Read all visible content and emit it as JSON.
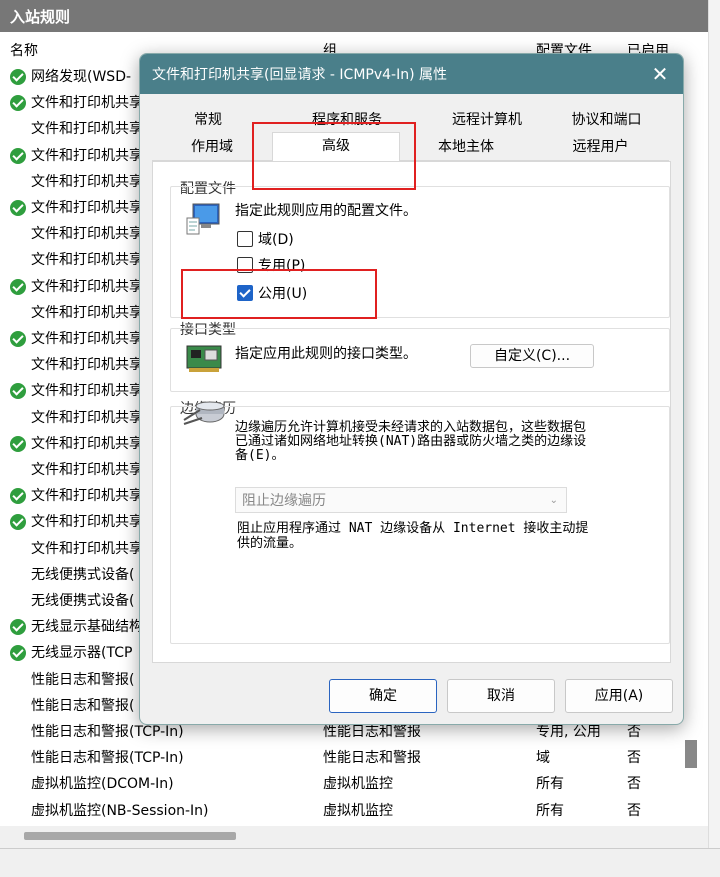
{
  "background_window": {
    "header": "入站规则",
    "columns": [
      "名称",
      "组",
      "配置文件",
      "已启用"
    ],
    "rows": [
      {
        "enabled_icon": true,
        "name": "网络发现(WSD-",
        "group": "",
        "profile": "",
        "enabled": ""
      },
      {
        "enabled_icon": true,
        "name": "文件和打印机共享",
        "group": "",
        "profile": "",
        "enabled": ""
      },
      {
        "enabled_icon": false,
        "name": "文件和打印机共享",
        "group": "",
        "profile": "",
        "enabled": ""
      },
      {
        "enabled_icon": true,
        "name": "文件和打印机共享",
        "group": "",
        "profile": "",
        "enabled": ""
      },
      {
        "enabled_icon": false,
        "name": "文件和打印机共享",
        "group": "",
        "profile": "",
        "enabled": ""
      },
      {
        "enabled_icon": true,
        "name": "文件和打印机共享",
        "group": "",
        "profile": "",
        "enabled": ""
      },
      {
        "enabled_icon": false,
        "name": "文件和打印机共享",
        "group": "",
        "profile": "",
        "enabled": ""
      },
      {
        "enabled_icon": false,
        "name": "文件和打印机共享",
        "group": "",
        "profile": "",
        "enabled": ""
      },
      {
        "enabled_icon": true,
        "name": "文件和打印机共享",
        "group": "",
        "profile": "",
        "enabled": ""
      },
      {
        "enabled_icon": false,
        "name": "文件和打印机共享",
        "group": "",
        "profile": "",
        "enabled": ""
      },
      {
        "enabled_icon": true,
        "name": "文件和打印机共享",
        "group": "",
        "profile": "",
        "enabled": ""
      },
      {
        "enabled_icon": false,
        "name": "文件和打印机共享",
        "group": "",
        "profile": "",
        "enabled": ""
      },
      {
        "enabled_icon": true,
        "name": "文件和打印机共享",
        "group": "",
        "profile": "",
        "enabled": ""
      },
      {
        "enabled_icon": false,
        "name": "文件和打印机共享",
        "group": "",
        "profile": "",
        "enabled": ""
      },
      {
        "enabled_icon": true,
        "name": "文件和打印机共享",
        "group": "",
        "profile": "",
        "enabled": ""
      },
      {
        "enabled_icon": false,
        "name": "文件和打印机共享",
        "group": "",
        "profile": "",
        "enabled": ""
      },
      {
        "enabled_icon": true,
        "name": "文件和打印机共享",
        "group": "",
        "profile": "",
        "enabled": ""
      },
      {
        "enabled_icon": true,
        "name": "文件和打印机共享",
        "group": "",
        "profile": "",
        "enabled": ""
      },
      {
        "enabled_icon": false,
        "name": "文件和打印机共享",
        "group": "",
        "profile": "",
        "enabled": ""
      },
      {
        "enabled_icon": false,
        "name": "无线便携式设备(",
        "group": "",
        "profile": "",
        "enabled": ""
      },
      {
        "enabled_icon": false,
        "name": "无线便携式设备(",
        "group": "",
        "profile": "",
        "enabled": ""
      },
      {
        "enabled_icon": true,
        "name": "无线显示基础结构",
        "group": "",
        "profile": "",
        "enabled": ""
      },
      {
        "enabled_icon": true,
        "name": "无线显示器(TCP",
        "group": "",
        "profile": "",
        "enabled": ""
      },
      {
        "enabled_icon": false,
        "name": "性能日志和警报(",
        "group": "",
        "profile": "",
        "enabled": ""
      },
      {
        "enabled_icon": false,
        "name": "性能日志和警报(",
        "group": "",
        "profile": "",
        "enabled": ""
      },
      {
        "enabled_icon": false,
        "name": "性能日志和警报(TCP-In)",
        "group": "性能日志和警报",
        "profile": "专用, 公用",
        "enabled": "否"
      },
      {
        "enabled_icon": false,
        "name": "性能日志和警报(TCP-In)",
        "group": "性能日志和警报",
        "profile": "域",
        "enabled": "否"
      },
      {
        "enabled_icon": false,
        "name": "虚拟机监控(DCOM-In)",
        "group": "虚拟机监控",
        "profile": "所有",
        "enabled": "否"
      },
      {
        "enabled_icon": false,
        "name": "虚拟机监控(NB-Session-In)",
        "group": "虚拟机监控",
        "profile": "所有",
        "enabled": "否"
      }
    ]
  },
  "dialog": {
    "title": "文件和打印机共享(回显请求 - ICMPv4-In) 属性",
    "close_glyph": "✕",
    "tabs_row1": [
      "常规",
      "程序和服务",
      "远程计算机",
      "协议和端口"
    ],
    "tabs_row2": [
      "作用域",
      "高级",
      "本地主体",
      "远程用户"
    ],
    "active_tab": "高级",
    "profiles": {
      "group_label": "配置文件",
      "description": "指定此规则应用的配置文件。",
      "options": [
        {
          "label": "域(D)",
          "checked": false
        },
        {
          "label": "专用(P)",
          "checked": false
        },
        {
          "label": "公用(U)",
          "checked": true
        }
      ]
    },
    "interface": {
      "group_label": "接口类型",
      "description": "指定应用此规则的接口类型。",
      "customize_button": "自定义(C)..."
    },
    "edge": {
      "group_label": "边缘遍历",
      "description": "边缘遍历允许计算机接受未经请求的入站数据包，这些数据包已通过诸如网络地址转换(NAT)路由器或防火墙之类的边缘设备(E)。",
      "select_value": "阻止边缘遍历",
      "note": "阻止应用程序通过 NAT 边缘设备从 Internet 接收主动提供的流量。"
    },
    "buttons": {
      "ok": "确定",
      "cancel": "取消",
      "apply": "应用(A)"
    }
  }
}
